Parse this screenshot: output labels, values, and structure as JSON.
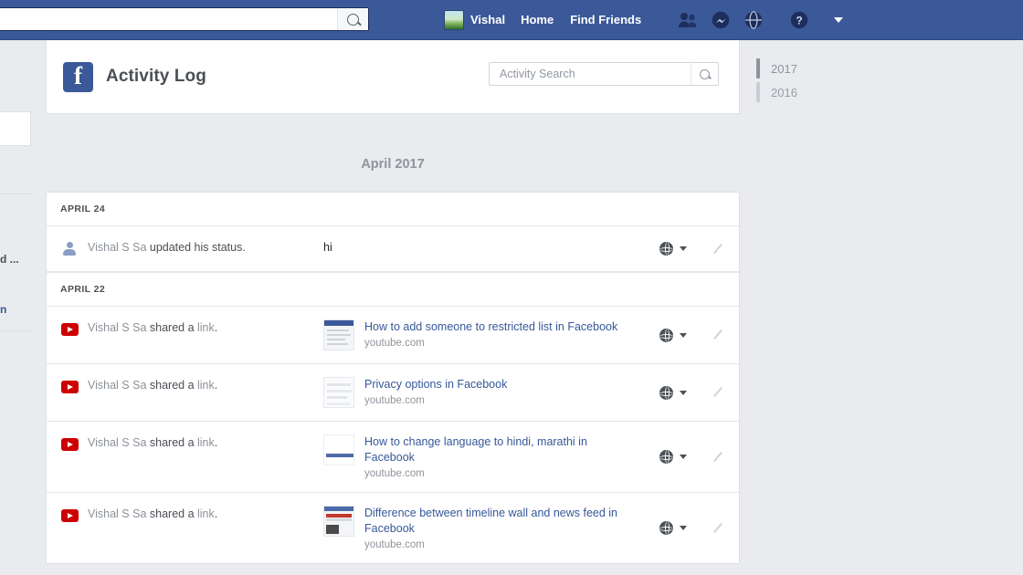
{
  "topnav": {
    "search_value": "",
    "search_placeholder": "",
    "search_icon": "search-icon",
    "profile_name": "Vishal",
    "home_label": "Home",
    "find_friends_label": "Find Friends",
    "icons": [
      {
        "name": "friend-requests-icon",
        "glyph": "two-people"
      },
      {
        "name": "messages-icon",
        "glyph": "messenger-bubble"
      },
      {
        "name": "notifications-icon",
        "glyph": "globe"
      },
      {
        "name": "help-icon",
        "glyph": "question-mark"
      }
    ],
    "bg_color": "#3b5998"
  },
  "left_strip": {
    "fragment_1": "d ...",
    "fragment_2": "n"
  },
  "log_header": {
    "logo": "facebook-f-logo",
    "title": "Activity Log",
    "search_value": "",
    "search_placeholder": "Activity Search",
    "search_icon": "search-icon"
  },
  "month_label": "April 2017",
  "activity": {
    "groups": [
      {
        "day": "APRIL 24",
        "rows": [
          {
            "icon": "person-icon",
            "actor": "Vishal S Sa",
            "action": " updated his status.",
            "kind": "status",
            "status_text": "hi",
            "privacy": "public-globe-icon",
            "edit": "edit-pencil-icon"
          }
        ]
      },
      {
        "day": "APRIL 22",
        "rows": [
          {
            "icon": "youtube-icon",
            "actor": "Vishal S Sa",
            "action": " shared a ",
            "action_link": "link",
            "action_end": ".",
            "kind": "link",
            "thumb": "screenshot-blue-header",
            "title": "How to add someone to restricted list in Facebook",
            "domain": "youtube.com",
            "privacy": "public-globe-icon",
            "edit": "edit-pencil-icon"
          },
          {
            "icon": "youtube-icon",
            "actor": "Vishal S Sa",
            "action": " shared a ",
            "action_link": "link",
            "action_end": ".",
            "kind": "link",
            "thumb": "screenshot-plain",
            "title": "Privacy options in Facebook",
            "domain": "youtube.com",
            "privacy": "public-globe-icon",
            "edit": "edit-pencil-icon"
          },
          {
            "icon": "youtube-icon",
            "actor": "Vishal S Sa",
            "action": " shared a ",
            "action_link": "link",
            "action_end": ".",
            "kind": "link",
            "thumb": "screenshot-blue-line",
            "title": "How to change language to hindi, marathi in Facebook",
            "domain": "youtube.com",
            "privacy": "public-globe-icon",
            "edit": "edit-pencil-icon"
          },
          {
            "icon": "youtube-icon",
            "actor": "Vishal S Sa",
            "action": " shared a ",
            "action_link": "link",
            "action_end": ".",
            "kind": "link",
            "thumb": "screenshot-flag",
            "title": "Difference between timeline wall and news feed in Facebook",
            "domain": "youtube.com",
            "privacy": "public-globe-icon",
            "edit": "edit-pencil-icon"
          }
        ]
      }
    ]
  },
  "year_rail": {
    "years": [
      {
        "label": "2017",
        "active": true
      },
      {
        "label": "2016",
        "active": false
      }
    ]
  },
  "colors": {
    "brand_blue": "#3b5998",
    "link_blue": "#365899",
    "page_bg": "#e9ebee",
    "youtube_red": "#cc0000",
    "muted_text": "#90949c"
  }
}
